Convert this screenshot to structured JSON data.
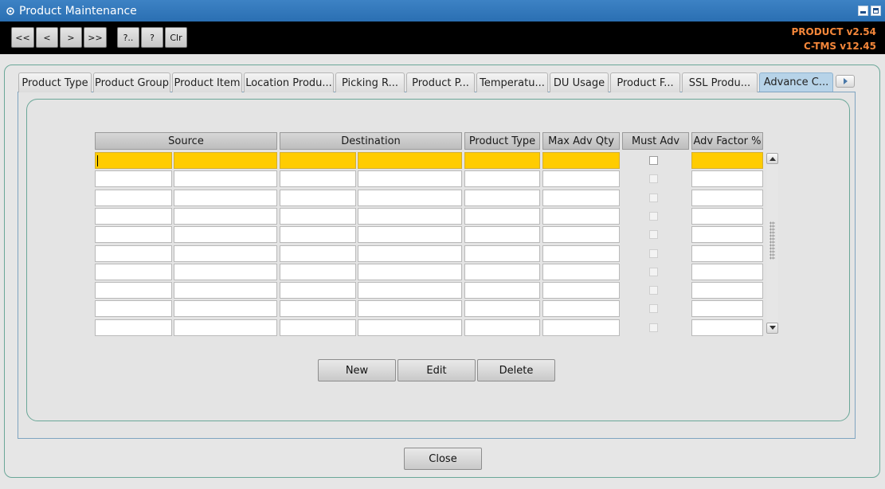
{
  "window": {
    "title": "Product Maintenance"
  },
  "toolbar": {
    "first_label": "<<",
    "prev_label": "<",
    "next_label": ">",
    "last_label": ">>",
    "query_label": "?..",
    "help_label": "?",
    "clear_label": "Clr",
    "product_version": "PRODUCT v2.54",
    "ctms_version": "C-TMS v12.45",
    "version_color": "#f5873a"
  },
  "tabs": [
    {
      "label": "Product Type"
    },
    {
      "label": "Product Group"
    },
    {
      "label": "Product Item"
    },
    {
      "label": "Location Produ..."
    },
    {
      "label": "Picking R..."
    },
    {
      "label": "Product P..."
    },
    {
      "label": "Temperatu..."
    },
    {
      "label": "DU Usage"
    },
    {
      "label": "Product F..."
    },
    {
      "label": "SSL Produ..."
    },
    {
      "label": "Advance C..."
    }
  ],
  "active_tab": "Advance C...",
  "grid": {
    "headers": {
      "source": "Source",
      "destination": "Destination",
      "product_type": "Product Type",
      "max_adv_qty": "Max Adv Qty",
      "must_adv": "Must Adv",
      "adv_factor": "Adv Factor %"
    },
    "selected_row_color": "#ffcc00",
    "rows": [
      {
        "source_1": "",
        "source_2": "",
        "dest_1": "",
        "dest_2": "",
        "product_type": "",
        "max_adv_qty": "",
        "must_adv": false,
        "adv_factor": ""
      },
      {
        "source_1": "",
        "source_2": "",
        "dest_1": "",
        "dest_2": "",
        "product_type": "",
        "max_adv_qty": "",
        "must_adv": false,
        "adv_factor": ""
      },
      {
        "source_1": "",
        "source_2": "",
        "dest_1": "",
        "dest_2": "",
        "product_type": "",
        "max_adv_qty": "",
        "must_adv": false,
        "adv_factor": ""
      },
      {
        "source_1": "",
        "source_2": "",
        "dest_1": "",
        "dest_2": "",
        "product_type": "",
        "max_adv_qty": "",
        "must_adv": false,
        "adv_factor": ""
      },
      {
        "source_1": "",
        "source_2": "",
        "dest_1": "",
        "dest_2": "",
        "product_type": "",
        "max_adv_qty": "",
        "must_adv": false,
        "adv_factor": ""
      },
      {
        "source_1": "",
        "source_2": "",
        "dest_1": "",
        "dest_2": "",
        "product_type": "",
        "max_adv_qty": "",
        "must_adv": false,
        "adv_factor": ""
      },
      {
        "source_1": "",
        "source_2": "",
        "dest_1": "",
        "dest_2": "",
        "product_type": "",
        "max_adv_qty": "",
        "must_adv": false,
        "adv_factor": ""
      },
      {
        "source_1": "",
        "source_2": "",
        "dest_1": "",
        "dest_2": "",
        "product_type": "",
        "max_adv_qty": "",
        "must_adv": false,
        "adv_factor": ""
      },
      {
        "source_1": "",
        "source_2": "",
        "dest_1": "",
        "dest_2": "",
        "product_type": "",
        "max_adv_qty": "",
        "must_adv": false,
        "adv_factor": ""
      },
      {
        "source_1": "",
        "source_2": "",
        "dest_1": "",
        "dest_2": "",
        "product_type": "",
        "max_adv_qty": "",
        "must_adv": false,
        "adv_factor": ""
      }
    ]
  },
  "actions": {
    "new_label": "New",
    "edit_label": "Edit",
    "delete_label": "Delete",
    "close_label": "Close"
  }
}
